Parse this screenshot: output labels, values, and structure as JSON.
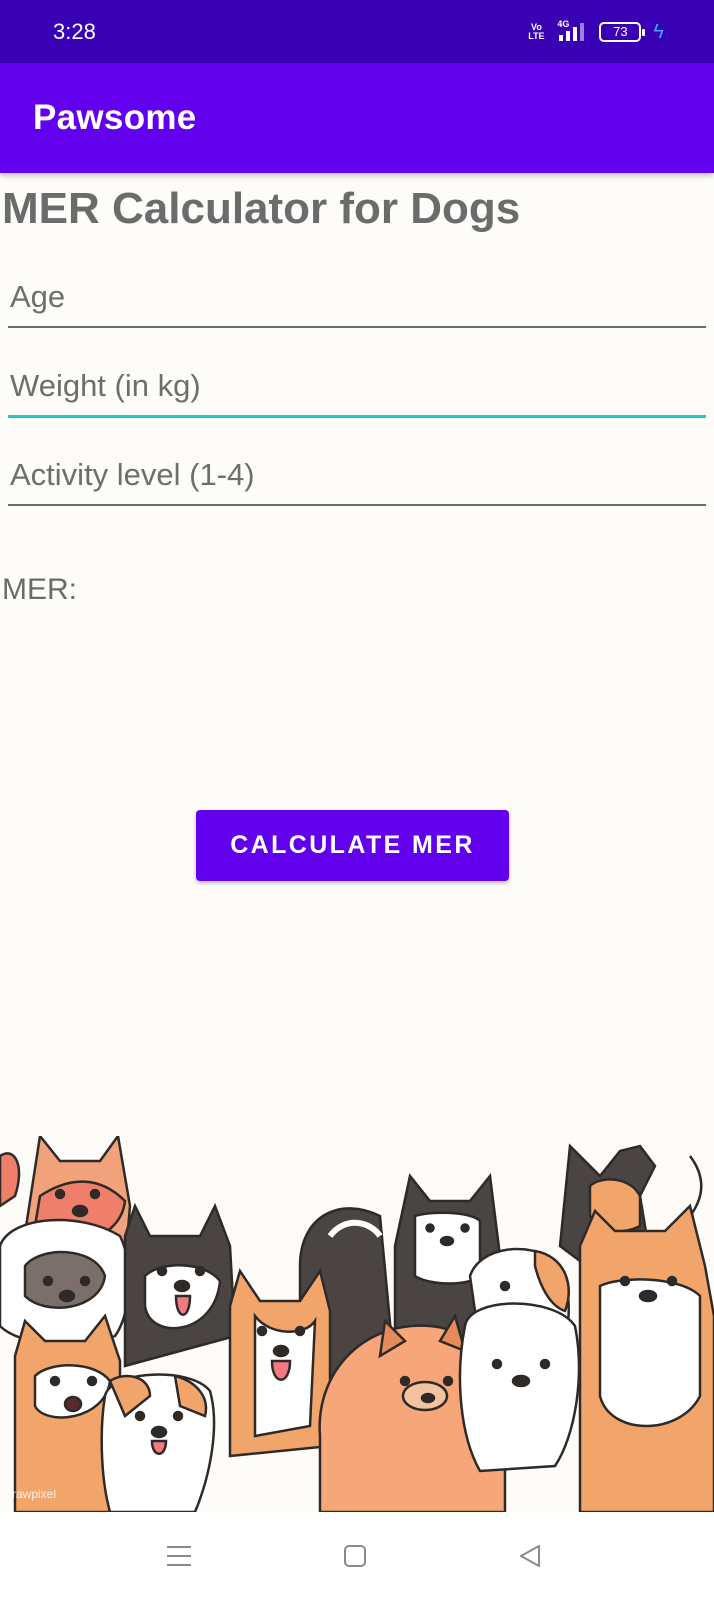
{
  "status_bar": {
    "time": "3:28",
    "network_tag": "4G",
    "volte": "Vo LTE",
    "battery": "73"
  },
  "app_bar": {
    "title": "Pawsome"
  },
  "page": {
    "title": "MER Calculator for Dogs"
  },
  "form": {
    "age": {
      "placeholder": "Age",
      "value": ""
    },
    "weight": {
      "placeholder": "Weight (in kg)",
      "value": ""
    },
    "activity": {
      "placeholder": "Activity level (1-4)",
      "value": ""
    }
  },
  "result": {
    "label": "MER:"
  },
  "actions": {
    "calculate_label": "CALCULATE MER"
  },
  "illustration": {
    "watermark": "rawpixel"
  },
  "nav": {
    "icons": [
      "menu-icon",
      "home-icon",
      "back-icon"
    ]
  },
  "colors": {
    "status_bar": "#3a00b4",
    "primary": "#6200ee",
    "focus_underline": "#26c6c4"
  }
}
